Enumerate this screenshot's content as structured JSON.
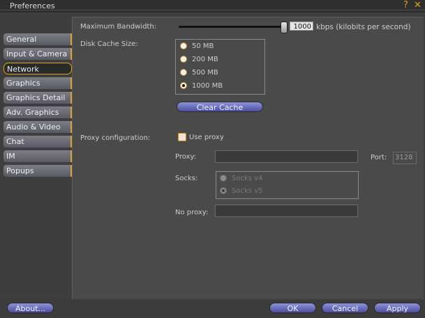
{
  "window": {
    "title": "Preferences",
    "help_glyph": "?",
    "close_glyph": "✕"
  },
  "tabs": [
    {
      "label": "General",
      "active": false
    },
    {
      "label": "Input & Camera",
      "active": false
    },
    {
      "label": "Network",
      "active": true
    },
    {
      "label": "Graphics",
      "active": false
    },
    {
      "label": "Graphics Detail",
      "active": false
    },
    {
      "label": "Adv. Graphics",
      "active": false
    },
    {
      "label": "Audio & Video",
      "active": false
    },
    {
      "label": "Chat",
      "active": false
    },
    {
      "label": "IM",
      "active": false
    },
    {
      "label": "Popups",
      "active": false
    }
  ],
  "network": {
    "bandwidth_label": "Maximum Bandwidth:",
    "bandwidth_value": "1000",
    "bandwidth_unit": "kbps (kilobits per second)",
    "bandwidth_slider_fraction": 0.97,
    "cache_label": "Disk Cache Size:",
    "cache_options": [
      "50 MB",
      "200 MB",
      "500 MB",
      "1000 MB"
    ],
    "cache_selected": "1000 MB",
    "clear_cache_label": "Clear Cache",
    "proxy_config_label": "Proxy configuration:",
    "use_proxy_label": "Use proxy",
    "use_proxy_checked": false,
    "proxy_label": "Proxy:",
    "proxy_value": "",
    "port_label": "Port:",
    "port_value": "3128",
    "socks_label": "Socks:",
    "socks_options": [
      "Socks v4",
      "Socks v5"
    ],
    "socks_selected": "Socks v5",
    "no_proxy_label": "No proxy:",
    "no_proxy_value": ""
  },
  "footer": {
    "about_label": "About...",
    "ok_label": "OK",
    "cancel_label": "Cancel",
    "apply_label": "Apply"
  },
  "colors": {
    "accent": "#e0a020",
    "button": "#6a6ec0",
    "panel": "#4a4a4a"
  }
}
